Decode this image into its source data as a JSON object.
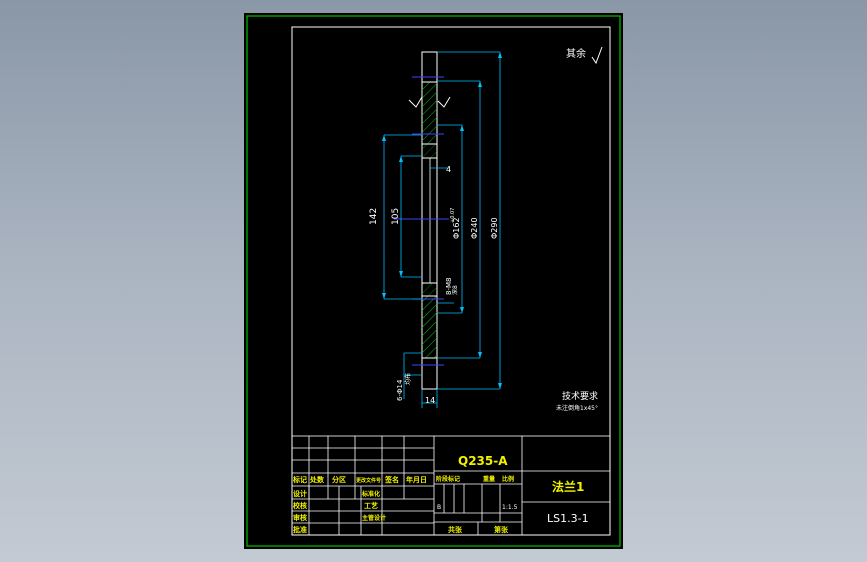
{
  "drawing": {
    "surface_finish": "其余",
    "tech_requirements_title": "技术要求",
    "tech_requirements_note": "未注倒角1x45°",
    "dimensions": {
      "d142": "142",
      "d105": "105",
      "d4": "4",
      "phi162": "Φ162",
      "phi162_tol": "+0.07",
      "phi240": "Φ240",
      "phi290": "Φ290",
      "m8": "8-M8",
      "m8_sub": "深8",
      "holes": "6-Φ14",
      "holes_sub": "均布",
      "thickness": "14"
    },
    "colors": {
      "frame": "#00c000",
      "part": "#ffffff",
      "hatch": "#00c000",
      "dimension": "#00c0ff",
      "center_line": "#4040ff",
      "title_text": "#f2f200"
    }
  },
  "title_block": {
    "material": "Q235-A",
    "part_name": "法兰1",
    "drawing_number": "LS1.3-1",
    "header_row": [
      "标记",
      "处数",
      "分区",
      "更改文件号",
      "签名",
      "年月日"
    ],
    "designer_label": "设计",
    "designer_std": "标准化",
    "review_label": "校核",
    "process_label": "工艺",
    "audit_label": "审核",
    "approve_label": "批准",
    "main_design_label": "主管设计",
    "stage_header": [
      "阶段标记",
      "重量",
      "比例"
    ],
    "stage_value": "B",
    "scale": "1:1.5",
    "sheets_total": "共张",
    "sheet_no": "第张"
  }
}
